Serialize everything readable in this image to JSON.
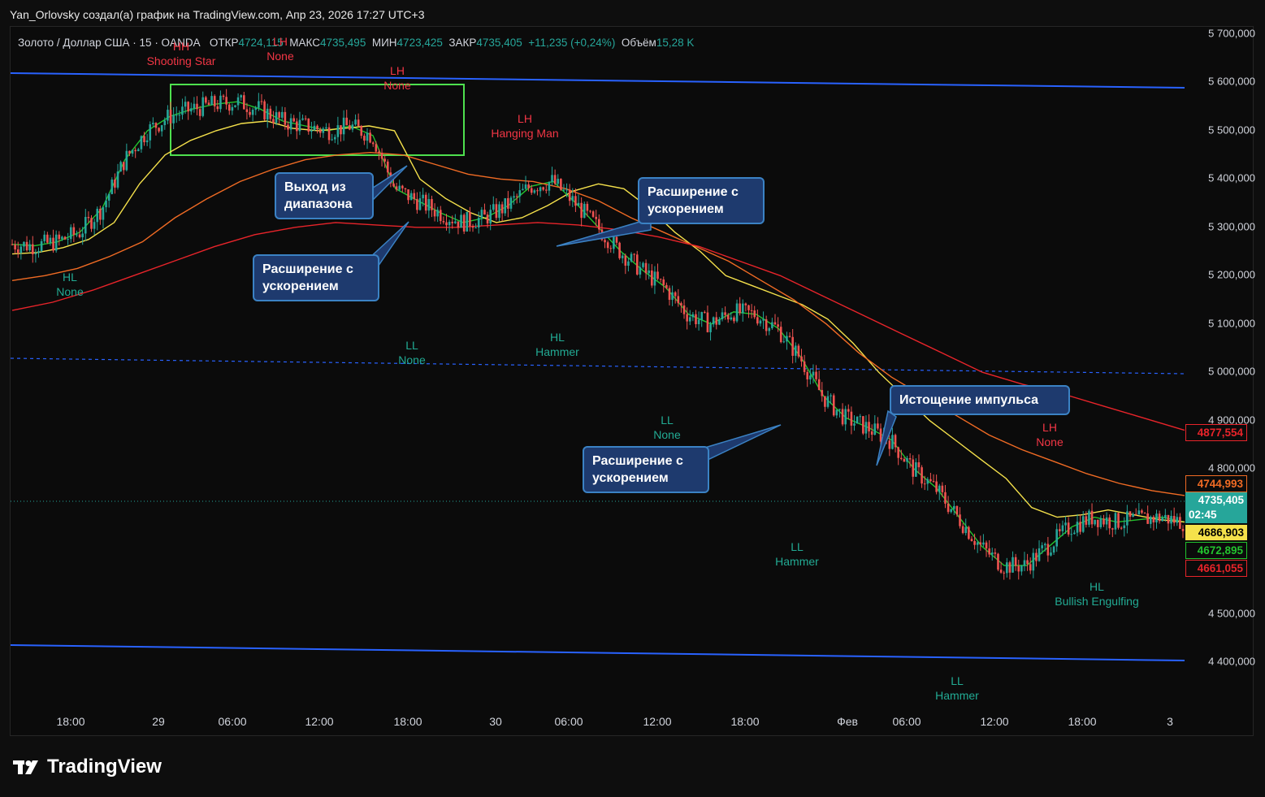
{
  "header": {
    "attribution": "Yan_Orlovsky создал(а) график на TradingView.com, Апр 23, 2026 17:27 UTC+3"
  },
  "info": {
    "symbol": "Золото / Доллар США · 15 · OANDA",
    "open_label": "ОТКР",
    "open": "4724,115",
    "high_label": "МАКС",
    "high": "4735,495",
    "low_label": "МИН",
    "low": "4723,425",
    "close_label": "ЗАКР",
    "close": "4735,405",
    "change": "+11,235 (+0,24%)",
    "volume_label": "Объём",
    "volume": "15,28 K"
  },
  "colors": {
    "up": "#26a69a",
    "down": "#ef5350",
    "ema_fast": "#22c32e",
    "ema_mid": "#f5e14b",
    "ema_slow": "#f06b24",
    "ema_long": "#e8242a",
    "channel": "#2962ff",
    "box": "#4ee04e"
  },
  "callouts": {
    "range_exit": "Выход из\nдиапазона",
    "accel1": "Расширение с\nускорением",
    "accel2": "Расширение с\nускорением",
    "accel3": "Расширение с\nускорением",
    "exhaustion": "Истощение импульса"
  },
  "pivot_labels": [
    {
      "text": "HH\nShooting Star",
      "color": "red"
    },
    {
      "text": "LH\nNone",
      "color": "red"
    },
    {
      "text": "LH\nNone",
      "color": "red"
    },
    {
      "text": "LH\nHanging Man",
      "color": "red"
    },
    {
      "text": "HL\nNone",
      "color": "teal"
    },
    {
      "text": "LL\nNone",
      "color": "teal"
    },
    {
      "text": "HL\nHammer",
      "color": "teal"
    },
    {
      "text": "LL\nNone",
      "color": "teal"
    },
    {
      "text": "LL\nHammer",
      "color": "teal"
    },
    {
      "text": "LL\nHammer",
      "color": "teal"
    },
    {
      "text": "HL\nBullish Engulfing",
      "color": "teal"
    },
    {
      "text": "LH\nNone",
      "color": "red"
    }
  ],
  "chart_data": {
    "type": "candlestick",
    "yaxis": {
      "min": 4330,
      "max": 5730,
      "ticks": [
        "5 700,000",
        "5 600,000",
        "5 500,000",
        "5 400,000",
        "5 300,000",
        "5 200,000",
        "5 100,000",
        "5 000,000",
        "4 900,000",
        "4 800,000",
        "4 500,000",
        "4 400,000"
      ],
      "tick_values": [
        5700,
        5600,
        5500,
        5400,
        5300,
        5200,
        5100,
        5000,
        4900,
        4800,
        4500,
        4400
      ]
    },
    "xaxis": {
      "ticks": [
        "18:00",
        "29",
        "06:00",
        "12:00",
        "18:00",
        "30",
        "06:00",
        "12:00",
        "18:00",
        "Фев",
        "06:00",
        "12:00",
        "18:00",
        "3"
      ]
    },
    "price_badges": [
      {
        "value": "4877,554",
        "color": "#e8242a",
        "style": "outline"
      },
      {
        "value": "4744,993",
        "color": "#f06b24",
        "style": "outline"
      },
      {
        "value": "4735,405",
        "sub": "02:45",
        "color": "#26a69a",
        "style": "fill"
      },
      {
        "value": "4686,903",
        "color": "#f5e14b",
        "style": "fill"
      },
      {
        "value": "4672,895",
        "color": "#22c32e",
        "style": "outline"
      },
      {
        "value": "4661,055",
        "color": "#e8242a",
        "style": "outline"
      }
    ],
    "dashed_level": 5025,
    "series": [
      {
        "name": "EMA fast",
        "values": [
          5265,
          5262,
          5270,
          5290,
          5340,
          5440,
          5500,
          5530,
          5545,
          5555,
          5560,
          5545,
          5520,
          5510,
          5500,
          5510,
          5490,
          5380,
          5355,
          5330,
          5310,
          5320,
          5345,
          5385,
          5395,
          5350,
          5300,
          5250,
          5210,
          5175,
          5120,
          5100,
          5125,
          5120,
          5090,
          5030,
          4950,
          4905,
          4885,
          4860,
          4800,
          4760,
          4700,
          4640,
          4600,
          4600,
          4640,
          4680,
          4700,
          4690,
          4695,
          4700,
          4690
        ]
      },
      {
        "name": "EMA mid",
        "values": [
          5245,
          5248,
          5258,
          5275,
          5310,
          5390,
          5450,
          5480,
          5500,
          5515,
          5520,
          5505,
          5500,
          5505,
          5510,
          5500,
          5400,
          5360,
          5330,
          5310,
          5320,
          5345,
          5375,
          5390,
          5380,
          5340,
          5290,
          5250,
          5200,
          5180,
          5160,
          5140,
          5110,
          5060,
          5000,
          4950,
          4900,
          4860,
          4820,
          4780,
          4720,
          4700,
          4705,
          4715,
          4705,
          4695,
          4690
        ]
      },
      {
        "name": "EMA slow",
        "values": [
          5190,
          5200,
          5215,
          5240,
          5270,
          5320,
          5360,
          5395,
          5420,
          5440,
          5450,
          5455,
          5450,
          5430,
          5410,
          5400,
          5395,
          5380,
          5355,
          5320,
          5290,
          5260,
          5230,
          5190,
          5150,
          5100,
          5040,
          4990,
          4950,
          4910,
          4870,
          4840,
          4815,
          4790,
          4770,
          4755,
          4745
        ]
      },
      {
        "name": "EMA long",
        "values": [
          5128,
          5145,
          5170,
          5200,
          5230,
          5260,
          5285,
          5300,
          5310,
          5305,
          5300,
          5300,
          5305,
          5310,
          5305,
          5295,
          5280,
          5260,
          5230,
          5200,
          5160,
          5120,
          5080,
          5040,
          5000,
          4975,
          4955,
          4930,
          4905,
          4880
        ]
      }
    ]
  }
}
